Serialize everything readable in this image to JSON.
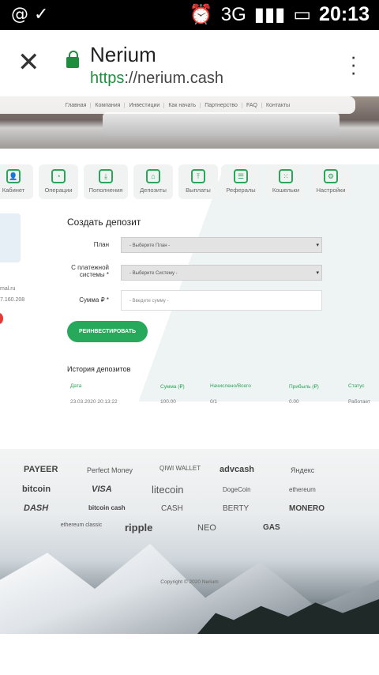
{
  "status_bar": {
    "left_icons": "@ ✓",
    "network": "3G",
    "time": "20:13"
  },
  "browser": {
    "title": "Nerium",
    "url_scheme": "https",
    "url_rest": "://nerium.cash"
  },
  "nav": [
    "Главная",
    "Компания",
    "Инвестиции",
    "Как начать",
    "Партнерство",
    "FAQ",
    "Контакты"
  ],
  "tiles": [
    "Кабинет",
    "Операции",
    "Пополнения",
    "Депозиты",
    "Выплаты",
    "Рефералы",
    "Кошельки",
    "Настройки"
  ],
  "sidebar": {
    "email": "mal.ru",
    "ip": "7.160.208"
  },
  "form": {
    "title": "Создать депозит",
    "plan_label": "План",
    "plan_placeholder": "- Выберите План -",
    "system_label": "С платежной системы *",
    "system_placeholder": "- Выберите Систему -",
    "amount_label": "Сумма ₽ *",
    "amount_placeholder": "- Введите сумму -",
    "button": "РЕИНВЕСТИРОВАТЬ"
  },
  "history": {
    "title": "История депозитов",
    "columns": [
      "Дата",
      "Сумма (₽)",
      "Начислено/Всего",
      "Прибыль (₽)",
      "Статус"
    ],
    "rows": [
      [
        "23.03.2020 20:13:22",
        "100.00",
        "0/1",
        "0.00",
        "Работает"
      ]
    ]
  },
  "payment_logos": [
    "PAYEER",
    "Perfect Money",
    "QIWI WALLET",
    "advcash",
    "Яндекс",
    "bitcoin",
    "VISA",
    "litecoin",
    "DogeCoin",
    "ethereum",
    "DASH",
    "bitcoin cash",
    "CASH",
    "BERTY",
    "MONERO",
    "ethereum classic",
    "ripple",
    "NEO",
    "GAS"
  ],
  "copyright": "Copyright © 2020 Nerium"
}
